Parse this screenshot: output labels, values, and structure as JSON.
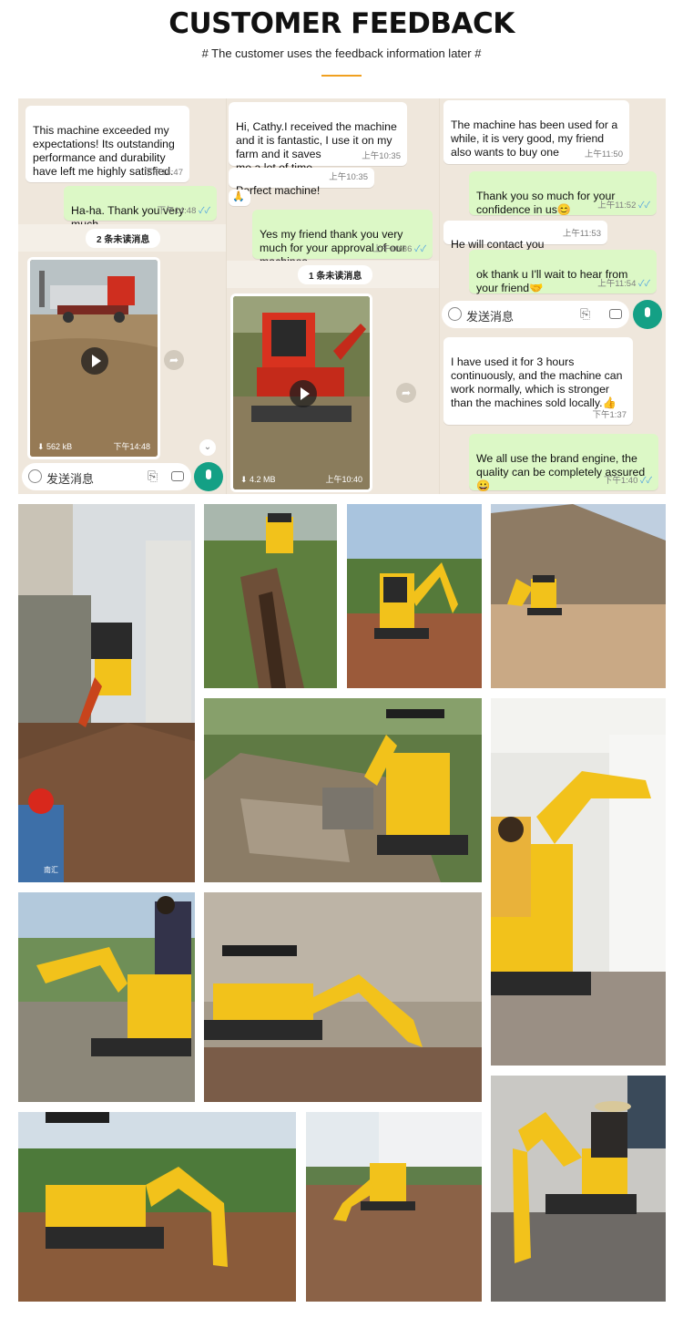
{
  "header": {
    "title": "CUSTOMER FEEDBACK",
    "subtitle": "# The customer uses the feedback information later #",
    "accent_color": "#f0a020"
  },
  "chat": {
    "background_color": "#efe7dc",
    "composer_placeholder": "发送消息",
    "column1": {
      "msg1": {
        "text": "This machine exceeded my expectations! Its outstanding performance and durability have left me highly satisfied.",
        "time": "下午14:47"
      },
      "msg2": {
        "text": "Ha-ha. Thank you very much.",
        "time": "下午14:48"
      },
      "unread": "2 条未读消息",
      "video": {
        "size": "562 kB",
        "time": "下午14:48"
      }
    },
    "column2": {
      "msg1": {
        "text": "Hi, Cathy.I received the machine and it is fantastic, I use it on my farm and it saves\nme a lot of time.",
        "time": "上午10:35"
      },
      "msg2": {
        "text": "Perfect machine!",
        "time": "上午10:35"
      },
      "msg2_emoji": "🙏",
      "msg3": {
        "text": "Yes my friend thank you very much for your approval of our machines",
        "time": "上午10:36"
      },
      "unread": "1 条未读消息",
      "video": {
        "size": "4.2 MB",
        "time": "上午10:40"
      }
    },
    "column3": {
      "msg1": {
        "text": "The machine has been used for a while, it is very good, my friend also wants to buy one",
        "time": "上午11:50"
      },
      "msg2": {
        "text": "Thank you so much for your confidence in us😊",
        "time": "上午11:52"
      },
      "msg3": {
        "text": "He will contact you",
        "time": "上午11:53"
      },
      "msg4": {
        "text": "ok thank u I'll wait to hear from your friend🤝",
        "time": "上午11:54"
      },
      "msg5": {
        "text": "I have used it for 3 hours continuously, and the machine can work normally, which is stronger than the machines sold locally.👍",
        "time": "下午1:37"
      },
      "msg6": {
        "text": "We all use the brand engine, the quality can be completely assured😀",
        "time": "下午1:40"
      }
    }
  },
  "gallery": {
    "excavator_color": "#f2c21b",
    "photo_caption": "南汇"
  }
}
